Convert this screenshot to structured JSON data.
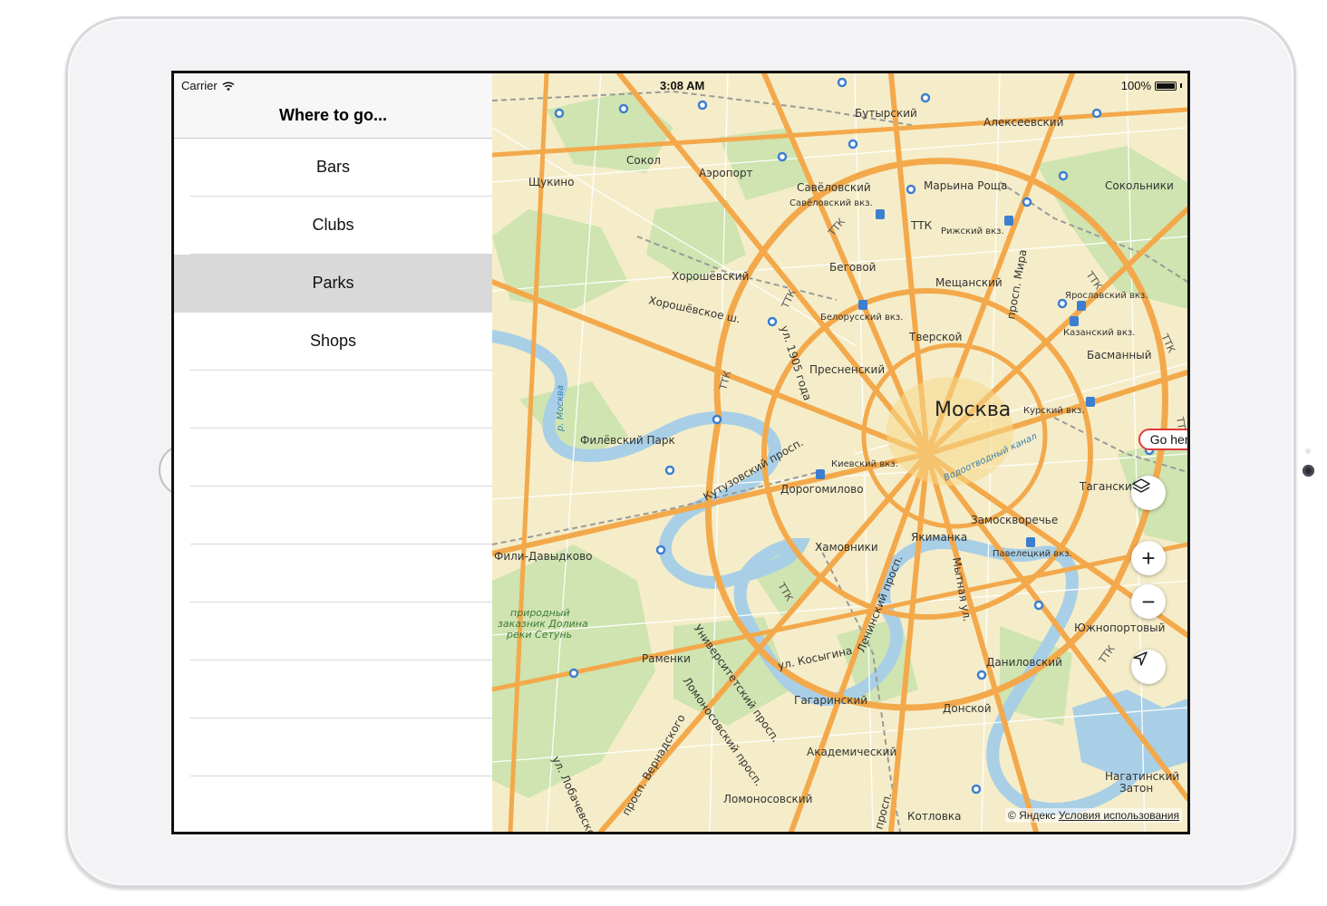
{
  "status_bar": {
    "carrier": "Carrier",
    "time": "3:08 AM",
    "battery": "100%"
  },
  "sidebar": {
    "title": "Where to go...",
    "items": [
      {
        "label": "Bars",
        "selected": false
      },
      {
        "label": "Clubs",
        "selected": false
      },
      {
        "label": "Parks",
        "selected": true
      },
      {
        "label": "Shops",
        "selected": false
      },
      {
        "label": "",
        "selected": false
      },
      {
        "label": "",
        "selected": false
      },
      {
        "label": "",
        "selected": false
      },
      {
        "label": "",
        "selected": false
      },
      {
        "label": "",
        "selected": false
      },
      {
        "label": "",
        "selected": false
      },
      {
        "label": "",
        "selected": false
      }
    ]
  },
  "map": {
    "city_label": "Москва",
    "callout": "Go here",
    "copyright": "© Яндекс",
    "terms_link": "Условия использования",
    "district_labels": {
      "butyrsky": "Бутырский",
      "alekseevsky": "Алексеевский",
      "sokol": "Сокол",
      "aeroport": "Аэропорт",
      "shchukino": "Щукино",
      "savelovsky": "Савёловский",
      "savelovsky_station": "Савёловский вкз.",
      "marina_roshcha": "Марьина Роща",
      "sokolniki": "Сокольники",
      "ttk1": "ТТК",
      "ttk2": "ТТК",
      "ttk3": "ТТК",
      "ttk4": "ТТК",
      "ttk5": "ТТК",
      "ttk6": "ТТК",
      "ttk7": "ТТК",
      "ttk8": "ТТК",
      "ttk9": "ТТК",
      "rizhsky_station": "Рижский вкз.",
      "begovoy": "Беговой",
      "prosp_mira": "просп. Мира",
      "khoroshevsky": "Хорошёвский",
      "khoroshevskoe_sh": "Хорошёвское ш.",
      "meshchansky": "Мещанский",
      "yaroslavsky_station": "Ярославский вкз.",
      "belorussky_station": "Белорусский вкз.",
      "kazansky_station": "Казанский вкз.",
      "tverskoy": "Тверской",
      "basmanny": "Басманный",
      "ul_1905": "ул. 1905 года",
      "presnensky": "Пресненский",
      "r_moskva": "р. Москва",
      "kursky_station": "Курский вкз.",
      "filevsky_park": "Филёвский Парк",
      "kievsky_station": "Киевский вкз.",
      "kutuzovsky": "Кутузовский просп.",
      "vodootvodny": "Водоотводный канал",
      "tagansky": "Таганский",
      "dorogomilovo": "Дорогомилово",
      "zamoskvorechye": "Замоскворечье",
      "fili_davydkovo": "Фили-Давыдково",
      "khamovniki": "Хамовники",
      "yakimanka": "Якиманка",
      "paveletsky_station": "Павелецкий вкз.",
      "leninsky": "Ленинский просп.",
      "mytnaya": "Мытная ул.",
      "reserve1": "природный",
      "reserve2": "заказник Долина",
      "reserve3": "реки Сетунь",
      "yuzhnoportovy": "Южнопортовый",
      "ramenki": "Раменки",
      "universitetsky": "Университетский просп.",
      "kosygina": "ул. Косыгина",
      "danilovsky": "Даниловский",
      "gagarinsky": "Гагаринский",
      "lomonosovsky_prosp": "Ломоносовский просп.",
      "donskoy": "Донской",
      "akademichesky": "Академический",
      "vernadskogo": "просп. Вернадского",
      "nagatinsky1": "Нагатинский",
      "nagatinsky2": "Затон",
      "lomonosovsky": "Ломоносовский",
      "lobachevskogo": "ул. Лобачевского",
      "kotlovka": "Котловка",
      "prosp_short": "просп."
    }
  },
  "controls": {
    "layers_icon": "layers-icon",
    "zoom_in_symbol": "+",
    "zoom_out_symbol": "−",
    "locate_icon": "location-arrow-icon"
  }
}
